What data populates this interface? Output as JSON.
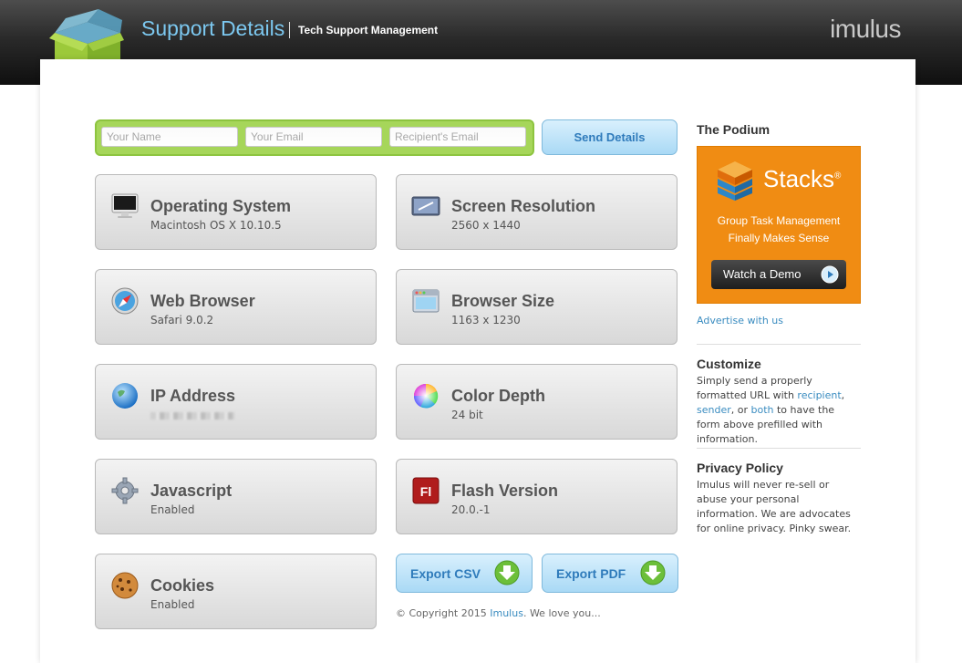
{
  "header": {
    "title": "Support Details",
    "subtitle": "Tech Support Management",
    "brand": "imulus"
  },
  "form": {
    "name_placeholder": "Your Name",
    "email_placeholder": "Your Email",
    "recipient_placeholder": "Recipient's Email",
    "send_label": "Send Details"
  },
  "cards": {
    "os": {
      "title": "Operating System",
      "value": "Macintosh OS X 10.10.5",
      "icon": "monitor-icon"
    },
    "resolution": {
      "title": "Screen Resolution",
      "value": "2560 x 1440",
      "icon": "screen-icon"
    },
    "browser": {
      "title": "Web Browser",
      "value": "Safari 9.0.2",
      "icon": "compass-icon"
    },
    "browser_size": {
      "title": "Browser Size",
      "value": "1163 x 1230",
      "icon": "window-icon"
    },
    "ip": {
      "title": "IP Address",
      "value": "",
      "icon": "globe-icon"
    },
    "color_depth": {
      "title": "Color Depth",
      "value": "24 bit",
      "icon": "color-wheel-icon"
    },
    "javascript": {
      "title": "Javascript",
      "value": "Enabled",
      "icon": "gear-icon"
    },
    "flash": {
      "title": "Flash Version",
      "value": "20.0.-1",
      "icon": "flash-icon",
      "icon_text": "Fl"
    },
    "cookies": {
      "title": "Cookies",
      "value": "Enabled",
      "icon": "cookie-icon"
    }
  },
  "export": {
    "csv_label": "Export CSV",
    "pdf_label": "Export PDF"
  },
  "footer": {
    "prefix": "© Copyright 2015",
    "link": "Imulus",
    "suffix": ". We love you..."
  },
  "sidebar": {
    "podium_title": "The Podium",
    "ad": {
      "name": "Stacks",
      "mark": "®",
      "tagline_1": "Group Task Management",
      "tagline_2": "Finally Makes Sense",
      "button": "Watch a Demo"
    },
    "advertise": "Advertise with us",
    "customize_title": "Customize",
    "customize_1": "Simply send a properly formatted URL with ",
    "customize_link_recipient": "recipient",
    "customize_2": ", ",
    "customize_link_sender": "sender",
    "customize_3": ", or ",
    "customize_link_both": "both",
    "customize_4": " to have the form above prefilled with information.",
    "privacy_title": "Privacy Policy",
    "privacy_text": "Imulus will never re-sell or abuse your personal information. We are advocates for online privacy. Pinky swear."
  },
  "colors": {
    "accent_blue": "#7cc8f0",
    "form_green": "#a6d65a",
    "ad_orange": "#f08c13",
    "link_blue": "#3a8cc0"
  }
}
